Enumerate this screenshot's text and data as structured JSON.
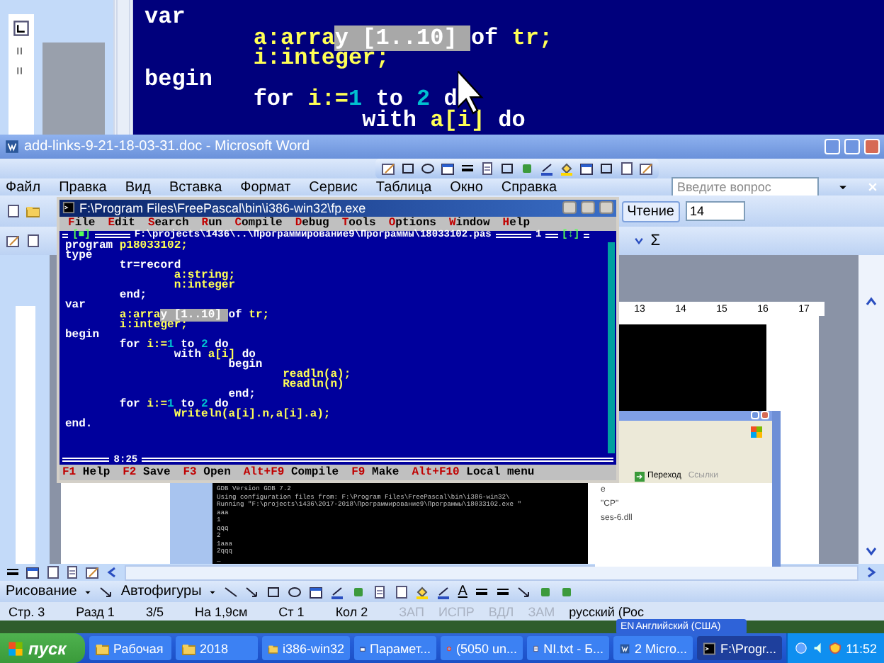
{
  "zoom_view": {
    "lines": [
      {
        "tokens": [
          {
            "text": "var",
            "kind": "plain"
          }
        ]
      },
      {
        "tokens": [
          {
            "text": "        a:arra",
            "kind": "ident"
          },
          {
            "text": "y [1..10] ",
            "kind": "selected"
          },
          {
            "text": "of",
            "kind": "plain"
          },
          {
            "text": " tr;",
            "kind": "ident"
          }
        ]
      },
      {
        "tokens": [
          {
            "text": "        i:integer;",
            "kind": "ident"
          }
        ]
      },
      {
        "tokens": [
          {
            "text": "begin",
            "kind": "plain"
          }
        ]
      },
      {
        "tokens": [
          {
            "text": "        for ",
            "kind": "plain"
          },
          {
            "text": "i:=",
            "kind": "ident"
          },
          {
            "text": "1",
            "kind": "number"
          },
          {
            "text": " to ",
            "kind": "plain"
          },
          {
            "text": "2",
            "kind": "number"
          },
          {
            "text": " d",
            "kind": "plain"
          }
        ]
      },
      {
        "tokens": [
          {
            "text": "                with ",
            "kind": "plain"
          },
          {
            "text": "a[i]",
            "kind": "ident"
          },
          {
            "text": " do",
            "kind": "plain"
          }
        ]
      }
    ]
  },
  "word": {
    "title": "add-links-9-21-18-03-31.doc - Microsoft Word",
    "menu": [
      "Файл",
      "Правка",
      "Вид",
      "Вставка",
      "Формат",
      "Сервис",
      "Таблица",
      "Окно",
      "Справка"
    ],
    "help_search": {
      "placeholder": "Введите вопрос"
    },
    "reading_button": "Чтение",
    "font_size": "14",
    "sum_symbol": "Σ",
    "ruler_numbers": [
      "13",
      "14",
      "15",
      "16",
      "17"
    ],
    "drawing_toolbar": {
      "drawing_menu": "Рисование",
      "autoshapes_menu": "Автофигуры",
      "font_color_letter": "A"
    },
    "status_bar": [
      {
        "text": "Стр. 3",
        "disabled": false
      },
      {
        "text": "Разд 1",
        "disabled": false
      },
      {
        "text": "3/5",
        "disabled": false
      },
      {
        "text": "На 1,9см",
        "disabled": false
      },
      {
        "text": "Ст 1",
        "disabled": false
      },
      {
        "text": "Кол 2",
        "disabled": false
      },
      {
        "text": "ЗАП",
        "disabled": true
      },
      {
        "text": "ИСПР",
        "disabled": true
      },
      {
        "text": "ВДЛ",
        "disabled": true
      },
      {
        "text": "ЗАМ",
        "disabled": true
      },
      {
        "text": "русский (Рос",
        "disabled": false
      }
    ]
  },
  "pascal_ide": {
    "title": "F:\\Program Files\\FreePascal\\bin\\i386-win32\\fp.exe",
    "menu": [
      "File",
      "Edit",
      "Search",
      "Run",
      "Compile",
      "Debug",
      "Tools",
      "Options",
      "Window",
      "Help"
    ],
    "editor": {
      "close_box": "[■]",
      "path": "F:\\projects\\1436\\..\\Программирование9\\Программы\\18033102.pas",
      "window_number": "1",
      "zoom_box": "[↕]",
      "cursor_position": "8:25",
      "lines": [
        {
          "tokens": [
            {
              "text": "program ",
              "kind": "plain"
            },
            {
              "text": "p18033102;",
              "kind": "ident"
            }
          ]
        },
        {
          "tokens": [
            {
              "text": "type",
              "kind": "plain"
            }
          ]
        },
        {
          "tokens": [
            {
              "text": "        tr=record",
              "kind": "plain"
            }
          ]
        },
        {
          "tokens": [
            {
              "text": "                a:string;",
              "kind": "ident"
            }
          ]
        },
        {
          "tokens": [
            {
              "text": "                n:integer",
              "kind": "ident"
            }
          ]
        },
        {
          "tokens": [
            {
              "text": "        end;",
              "kind": "plain"
            }
          ]
        },
        {
          "tokens": [
            {
              "text": "var",
              "kind": "plain"
            }
          ]
        },
        {
          "tokens": [
            {
              "text": "        a:arra",
              "kind": "ident"
            },
            {
              "text": "y [1..10] ",
              "kind": "selected"
            },
            {
              "text": "of",
              "kind": "plain"
            },
            {
              "text": " tr;",
              "kind": "ident"
            }
          ]
        },
        {
          "tokens": [
            {
              "text": "        i:integer;",
              "kind": "ident"
            }
          ]
        },
        {
          "tokens": [
            {
              "text": "begin",
              "kind": "plain"
            }
          ]
        },
        {
          "tokens": [
            {
              "text": "        for ",
              "kind": "plain"
            },
            {
              "text": "i:=",
              "kind": "ident"
            },
            {
              "text": "1",
              "kind": "number"
            },
            {
              "text": " to ",
              "kind": "plain"
            },
            {
              "text": "2",
              "kind": "number"
            },
            {
              "text": " do",
              "kind": "plain"
            }
          ]
        },
        {
          "tokens": [
            {
              "text": "                with ",
              "kind": "plain"
            },
            {
              "text": "a[i]",
              "kind": "ident"
            },
            {
              "text": " do",
              "kind": "plain"
            }
          ]
        },
        {
          "tokens": [
            {
              "text": "                        begin",
              "kind": "plain"
            }
          ]
        },
        {
          "tokens": [
            {
              "text": "                                readln(a);",
              "kind": "ident"
            }
          ]
        },
        {
          "tokens": [
            {
              "text": "                                Readln(n)",
              "kind": "ident"
            }
          ]
        },
        {
          "tokens": [
            {
              "text": "                        end;",
              "kind": "plain"
            }
          ]
        },
        {
          "tokens": [
            {
              "text": "        for ",
              "kind": "plain"
            },
            {
              "text": "i:=",
              "kind": "ident"
            },
            {
              "text": "1",
              "kind": "number"
            },
            {
              "text": " to ",
              "kind": "plain"
            },
            {
              "text": "2",
              "kind": "number"
            },
            {
              "text": " do",
              "kind": "plain"
            }
          ]
        },
        {
          "tokens": [
            {
              "text": "                Writeln(a[i].n,a[i].a);",
              "kind": "ident"
            }
          ]
        },
        {
          "tokens": [
            {
              "text": "end.",
              "kind": "plain"
            }
          ]
        }
      ]
    },
    "status_line": [
      {
        "key": "F1",
        "label": "Help"
      },
      {
        "key": "F2",
        "label": "Save"
      },
      {
        "key": "F3",
        "label": "Open"
      },
      {
        "key": "Alt+F9",
        "label": "Compile"
      },
      {
        "key": "F9",
        "label": "Make"
      },
      {
        "key": "Alt+F10",
        "label": "Local menu"
      }
    ]
  },
  "console": {
    "lines": [
      "GDB Version GDB 7.2",
      "Using configuration files from: F:\\Program Files\\FreePascal\\bin\\i386-win32\\",
      "Running \"F:\\projects\\1436\\2017-2018\\Программирование9\\Программы\\18033102.exe \"",
      "ааа",
      "1",
      "qqq",
      "2",
      "1ааа",
      "2qqq",
      "_"
    ]
  },
  "explorer": {
    "go_button": "Переход",
    "links": "Ссылки",
    "files": [
      "e",
      "\"CP\"",
      "ses-6.dll"
    ]
  },
  "language_bar": {
    "code": "EN",
    "label": "Английский (США)"
  },
  "taskbar": {
    "start": "пуск",
    "items": [
      {
        "label": "Рабочая",
        "kind": "folder",
        "selected": false
      },
      {
        "label": "2018",
        "kind": "folder",
        "selected": false
      },
      {
        "label": "i386-win32",
        "kind": "folder",
        "selected": false
      },
      {
        "label": "Парамет...",
        "kind": "window",
        "selected": false
      },
      {
        "label": "(5050 un...",
        "kind": "browser",
        "selected": false
      },
      {
        "label": "NI.txt - Б...",
        "kind": "notepad",
        "selected": false
      },
      {
        "label": "2 Micro...",
        "kind": "word",
        "selected": false
      },
      {
        "label": "F:\\Progr...",
        "kind": "console",
        "selected": true
      }
    ],
    "clock": "11:52"
  }
}
